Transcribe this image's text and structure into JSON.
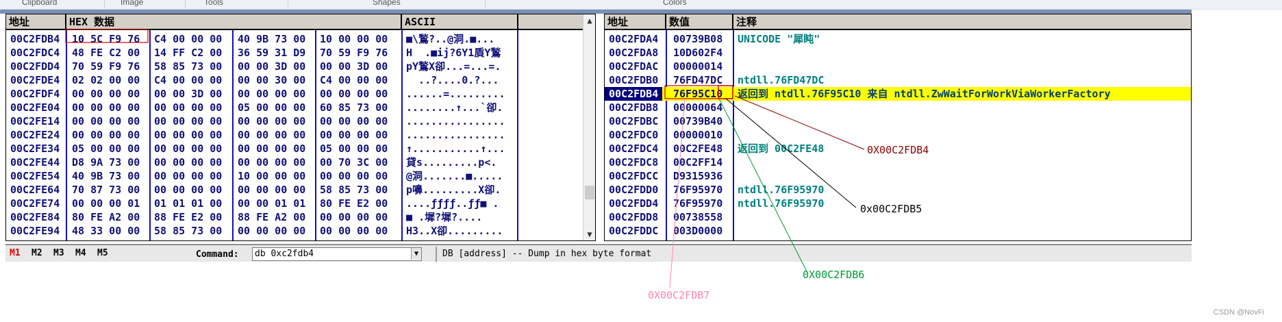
{
  "ribbon": {
    "labels": [
      "Clipboard",
      "Image",
      "Tools",
      "Shapes",
      "Colors"
    ]
  },
  "dump": {
    "headers": {
      "address": "地址",
      "hex": "HEX 数据",
      "ascii": "ASCII"
    },
    "rows": [
      {
        "addr": "00C2FDB4",
        "g1": "10 5C F9 76",
        "g2": "C4 00 00 00",
        "g3": "40 9B 73 00",
        "g4": "10 00 00 00",
        "ascii": "■\\鶖?..@洞.■..."
      },
      {
        "addr": "00C2FDC4",
        "g1": "48 FE C2 00",
        "g2": "14 FF C2 00",
        "g3": "36 59 31 D9",
        "g4": "70 59 F9 76",
        "ascii": "H  .■ij?6Y1貭Y鶖"
      },
      {
        "addr": "00C2FDD4",
        "g1": "70 59 F9 76",
        "g2": "58 85 73 00",
        "g3": "00 00 3D 00",
        "g4": "00 00 3D 00",
        "ascii": "pY鶖X卻...=...=."
      },
      {
        "addr": "00C2FDE4",
        "g1": "02 02 00 00",
        "g2": "C4 00 00 00",
        "g3": "00 00 30 00",
        "g4": "C4 00 00 00",
        "ascii": "  ..?....0.?..."
      },
      {
        "addr": "00C2FDF4",
        "g1": "00 00 00 00",
        "g2": "00 00 3D 00",
        "g3": "00 00 00 00",
        "g4": "00 00 00 00",
        "ascii": "......=........."
      },
      {
        "addr": "00C2FE04",
        "g1": "00 00 00 00",
        "g2": "00 00 00 00",
        "g3": "05 00 00 00",
        "g4": "60 85 73 00",
        "ascii": "........↑...`卻."
      },
      {
        "addr": "00C2FE14",
        "g1": "00 00 00 00",
        "g2": "00 00 00 00",
        "g3": "00 00 00 00",
        "g4": "00 00 00 00",
        "ascii": "................"
      },
      {
        "addr": "00C2FE24",
        "g1": "00 00 00 00",
        "g2": "00 00 00 00",
        "g3": "00 00 00 00",
        "g4": "00 00 00 00",
        "ascii": "................"
      },
      {
        "addr": "00C2FE34",
        "g1": "05 00 00 00",
        "g2": "00 00 00 00",
        "g3": "00 00 00 00",
        "g4": "05 00 00 00",
        "ascii": "↑...........↑..."
      },
      {
        "addr": "00C2FE44",
        "g1": "D8 9A 73 00",
        "g2": "00 00 00 00",
        "g3": "00 00 00 00",
        "g4": "00 70 3C 00",
        "ascii": "貸s.........p<."
      },
      {
        "addr": "00C2FE54",
        "g1": "40 9B 73 00",
        "g2": "00 00 00 00",
        "g3": "10 00 00 00",
        "g4": "00 00 00 00",
        "ascii": "@洞.......■....."
      },
      {
        "addr": "00C2FE64",
        "g1": "70 87 73 00",
        "g2": "00 00 00 00",
        "g3": "00 00 00 00",
        "g4": "58 85 73 00",
        "ascii": "p嚊.........X卻."
      },
      {
        "addr": "00C2FE74",
        "g1": "00 00 00 01",
        "g2": "01 01 01 00",
        "g3": "00 00 01 01",
        "g4": "80 FE E2 00",
        "ascii": "....ƒƒƒƒ..ƒƒ■ ."
      },
      {
        "addr": "00C2FE84",
        "g1": "80 FE A2 00",
        "g2": "88 FE E2 00",
        "g3": "88 FE A2 00",
        "g4": "00 00 00 00",
        "ascii": "■ .墀?墀?...."
      },
      {
        "addr": "00C2FE94",
        "g1": "48 33 00 00",
        "g2": "58 85 73 00",
        "g3": "00 00 00 00",
        "g4": "00 00 00 00",
        "ascii": "H3..X卻........."
      }
    ]
  },
  "stack": {
    "headers": {
      "address": "地址",
      "value": "数值",
      "comment": "注释"
    },
    "rows": [
      {
        "addr": "00C2FDA4",
        "val": "00739B08",
        "cmt": "UNICODE \"犀盹\"",
        "sel": false
      },
      {
        "addr": "00C2FDA8",
        "val": "10D602F4",
        "cmt": "",
        "sel": false
      },
      {
        "addr": "00C2FDAC",
        "val": "00000014",
        "cmt": "",
        "sel": false
      },
      {
        "addr": "00C2FDB0",
        "val": "76FD47DC",
        "cmt": "ntdll.76FD47DC",
        "sel": false
      },
      {
        "addr": "00C2FDB4",
        "val": "76F95C10",
        "cmt": "返回到 ntdll.76F95C10 来自 ntdll.ZwWaitForWorkViaWorkerFactory",
        "sel": true
      },
      {
        "addr": "00C2FDB8",
        "val": "00000064",
        "cmt": "",
        "sel": false
      },
      {
        "addr": "00C2FDBC",
        "val": "00739B40",
        "cmt": "",
        "sel": false
      },
      {
        "addr": "00C2FDC0",
        "val": "00000010",
        "cmt": "",
        "sel": false
      },
      {
        "addr": "00C2FDC4",
        "val": "00C2FE48",
        "cmt": "返回到 00C2FE48",
        "sel": false
      },
      {
        "addr": "00C2FDC8",
        "val": "00C2FF14",
        "cmt": "",
        "sel": false
      },
      {
        "addr": "00C2FDCC",
        "val": "D9315936",
        "cmt": "",
        "sel": false
      },
      {
        "addr": "00C2FDD0",
        "val": "76F95970",
        "cmt": "ntdll.76F95970",
        "sel": false
      },
      {
        "addr": "00C2FDD4",
        "val": "76F95970",
        "cmt": "ntdll.76F95970",
        "sel": false
      },
      {
        "addr": "00C2FDD8",
        "val": "00738558",
        "cmt": "",
        "sel": false
      },
      {
        "addr": "00C2FDDC",
        "val": "003D0000",
        "cmt": "",
        "sel": false
      }
    ]
  },
  "status": {
    "tabs": [
      "M1",
      "M2",
      "M3",
      "M4",
      "M5"
    ],
    "command_label": "Command:",
    "command_value": "db 0xc2fdb4",
    "hint": "DB [address] -- Dump in hex byte format"
  },
  "annotations": {
    "labels": [
      "0X00C2FDB4",
      "0x00C2FDB5",
      "0X00C2FDB6",
      "0X00C2FDB7"
    ],
    "colors": [
      "#8b0000",
      "#000000",
      "#009933",
      "#ff88aa"
    ]
  },
  "watermark": "CSDN @NovFi"
}
